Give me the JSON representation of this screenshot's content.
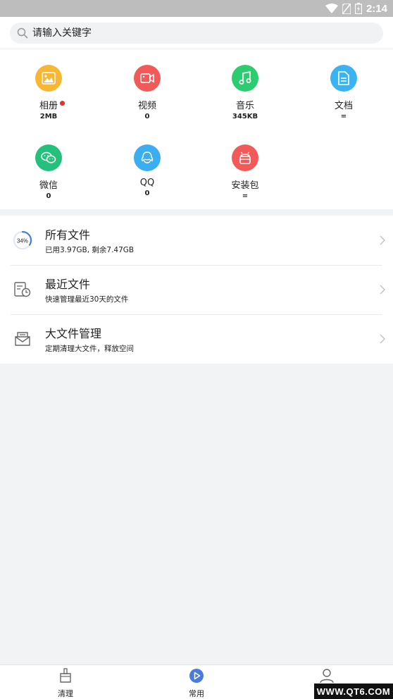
{
  "status_bar": {
    "time": "2:14"
  },
  "search": {
    "placeholder": "请输入关键字"
  },
  "categories": [
    {
      "label": "相册",
      "value": "2MB",
      "color": "#f7b733",
      "icon": "image-icon",
      "badge": true
    },
    {
      "label": "视频",
      "value": "0",
      "color": "#f25a5a",
      "icon": "video-icon"
    },
    {
      "label": "音乐",
      "value": "345KB",
      "color": "#2ecc71",
      "icon": "music-icon"
    },
    {
      "label": "文档",
      "value": "=",
      "color": "#3ab3f0",
      "icon": "document-icon"
    },
    {
      "label": "微信",
      "value": "0",
      "color": "#23c17b",
      "icon": "wechat-icon"
    },
    {
      "label": "QQ",
      "value": "0",
      "color": "#3aaef0",
      "icon": "qq-icon"
    },
    {
      "label": "安装包",
      "value": "=",
      "color": "#f25a5a",
      "icon": "android-icon"
    }
  ],
  "storage": {
    "percent": 34,
    "percent_label": "34%"
  },
  "file_list": [
    {
      "title": "所有文件",
      "subtitle": "已用3.97GB, 剩余7.47GB",
      "icon": "storage-ring-icon"
    },
    {
      "title": "最近文件",
      "subtitle": "快速管理最近30天的文件",
      "icon": "recent-files-icon"
    },
    {
      "title": "大文件管理",
      "subtitle": "定期清理大文件，释放空间",
      "icon": "large-files-icon"
    }
  ],
  "bottom_nav": [
    {
      "label": "清理",
      "icon": "broom-icon"
    },
    {
      "label": "常用",
      "icon": "play-circle-icon",
      "active": true
    },
    {
      "label": "",
      "icon": "user-icon"
    }
  ],
  "watermark": "WWW.QT6.COM",
  "colors": {
    "accent": "#4a7bdc",
    "status_bar": "#bdbdbd"
  }
}
